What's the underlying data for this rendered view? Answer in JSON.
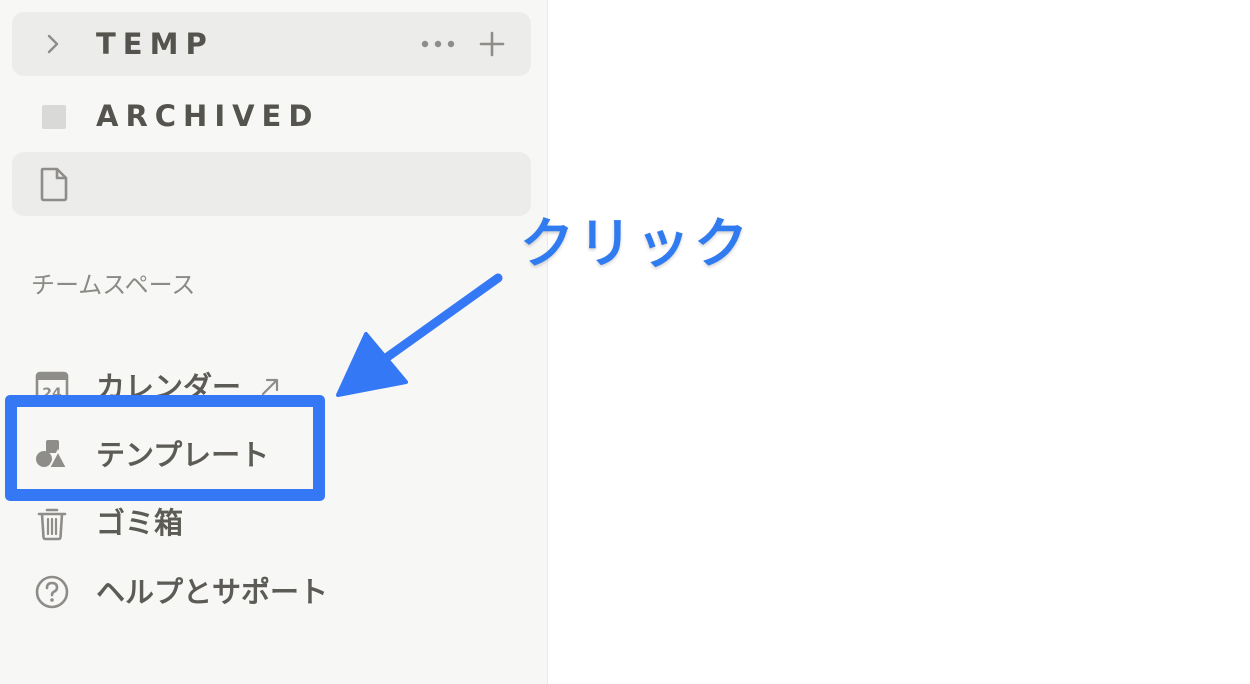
{
  "sidebar": {
    "rows": {
      "temp_label": "TEMP",
      "archived_label": "ARCHIVED"
    },
    "section_label": "チームスペース",
    "nav": {
      "calendar_label": "カレンダー",
      "template_label": "テンプレート",
      "trash_label": "ゴミ箱",
      "help_label": "ヘルプとサポート"
    },
    "calendar_icon_day": "24"
  },
  "annotation": {
    "click_text": "クリック"
  },
  "colors": {
    "accent": "#3478f6",
    "sidebar_bg": "#f7f7f5",
    "text": "#5d5b56"
  },
  "icons": {
    "temp_row": [
      "chevron-right-icon",
      "more-horizontal-icon",
      "plus-icon"
    ],
    "archived_row": [
      "square-icon"
    ],
    "page_row": [
      "document-icon"
    ],
    "nav": [
      "calendar-icon",
      "template-shapes-icon",
      "trash-icon",
      "help-circle-icon"
    ]
  }
}
